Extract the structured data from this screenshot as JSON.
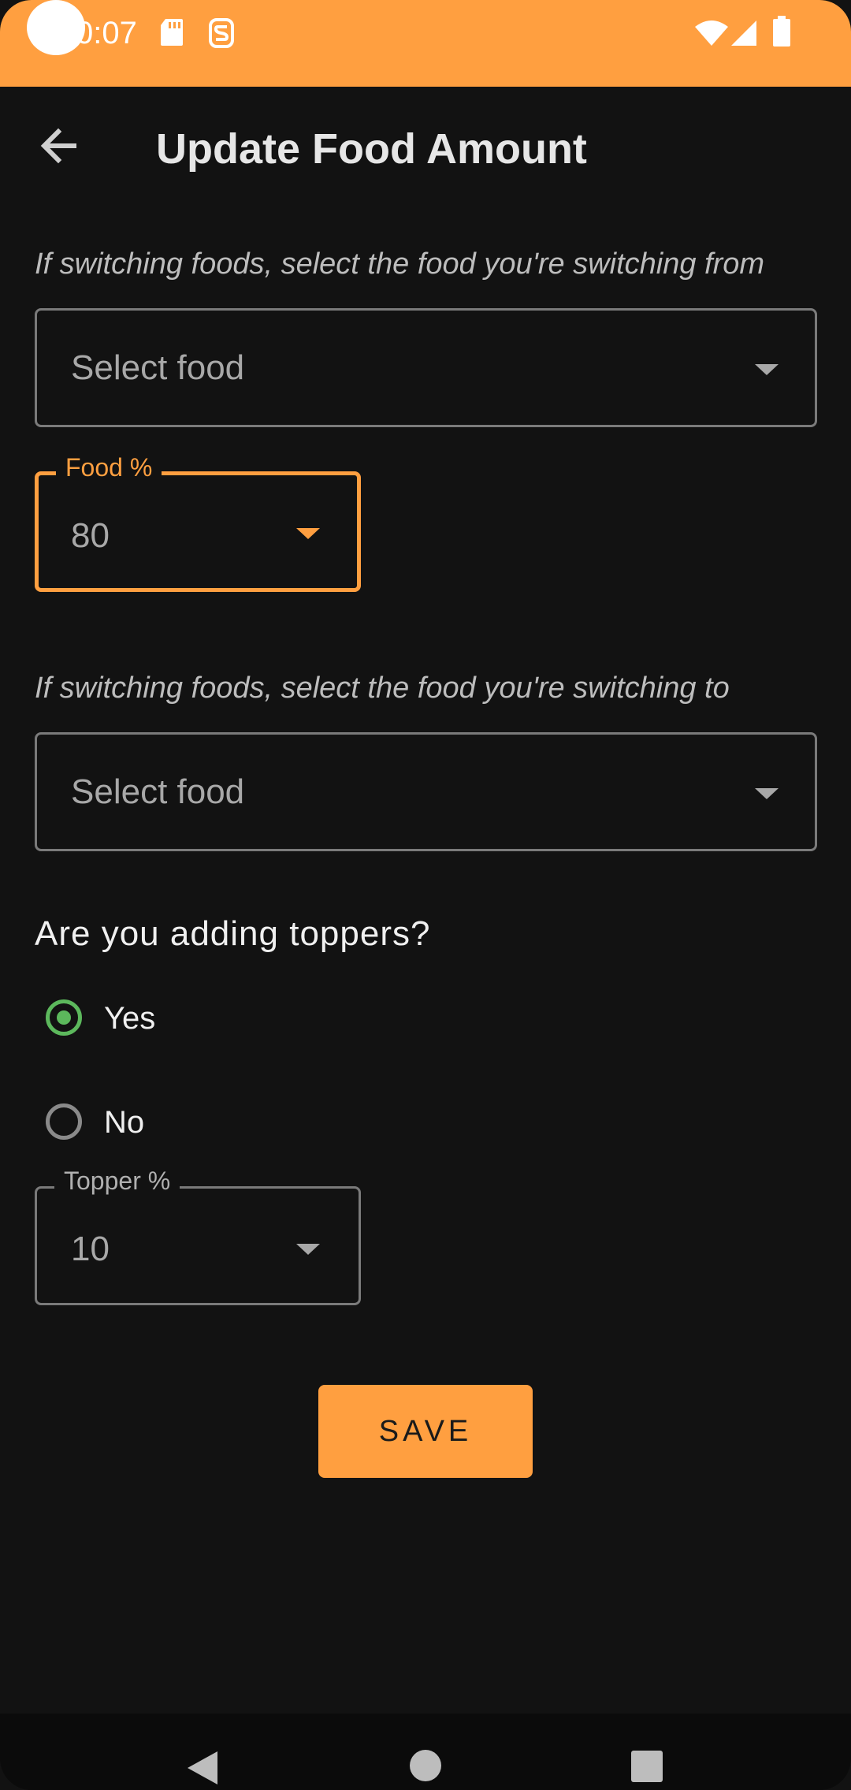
{
  "status_bar": {
    "time": "0:07"
  },
  "app_bar": {
    "title": "Update Food Amount"
  },
  "switch_from": {
    "hint": "If switching foods, select the food you're switching from",
    "placeholder": "Select food"
  },
  "food_percent": {
    "label": "Food %",
    "value": "80"
  },
  "switch_to": {
    "hint": "If switching foods, select the food you're switching to",
    "placeholder": "Select food"
  },
  "toppers": {
    "question": "Are you adding toppers?",
    "options": [
      {
        "label": "Yes",
        "checked": true
      },
      {
        "label": "No",
        "checked": false
      }
    ]
  },
  "topper_percent": {
    "label": "Topper %",
    "value": "10"
  },
  "actions": {
    "save_label": "SAVE"
  },
  "colors": {
    "accent": "#ff9f40",
    "radio_checked": "#5cb85c",
    "background": "#121212"
  }
}
